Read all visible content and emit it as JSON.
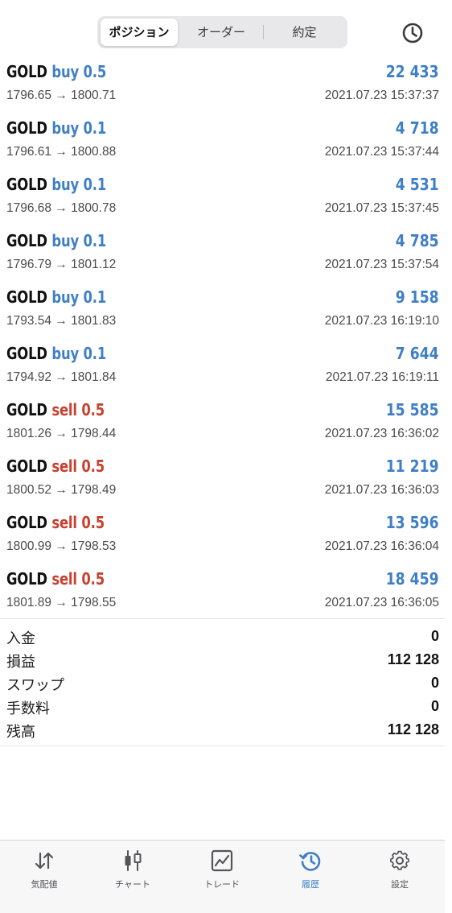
{
  "header": {
    "tabs": [
      {
        "label": "ポジション"
      },
      {
        "label": "オーダー"
      },
      {
        "label": "約定"
      }
    ],
    "active_tab": "ポジション",
    "right_icon": "clock-history-icon"
  },
  "deals": [
    {
      "symbol": "GOLD",
      "type": "buy",
      "volume": "0.5",
      "open": "1796.65",
      "close": "1800.71",
      "profit": "22 433",
      "time": "2021.07.23 15:37:37"
    },
    {
      "symbol": "GOLD",
      "type": "buy",
      "volume": "0.1",
      "open": "1796.61",
      "close": "1800.88",
      "profit": "4 718",
      "time": "2021.07.23 15:37:44"
    },
    {
      "symbol": "GOLD",
      "type": "buy",
      "volume": "0.1",
      "open": "1796.68",
      "close": "1800.78",
      "profit": "4 531",
      "time": "2021.07.23 15:37:45"
    },
    {
      "symbol": "GOLD",
      "type": "buy",
      "volume": "0.1",
      "open": "1796.79",
      "close": "1801.12",
      "profit": "4 785",
      "time": "2021.07.23 15:37:54"
    },
    {
      "symbol": "GOLD",
      "type": "buy",
      "volume": "0.1",
      "open": "1793.54",
      "close": "1801.83",
      "profit": "9 158",
      "time": "2021.07.23 16:19:10"
    },
    {
      "symbol": "GOLD",
      "type": "buy",
      "volume": "0.1",
      "open": "1794.92",
      "close": "1801.84",
      "profit": "7 644",
      "time": "2021.07.23 16:19:11"
    },
    {
      "symbol": "GOLD",
      "type": "sell",
      "volume": "0.5",
      "open": "1801.26",
      "close": "1798.44",
      "profit": "15 585",
      "time": "2021.07.23 16:36:02"
    },
    {
      "symbol": "GOLD",
      "type": "sell",
      "volume": "0.5",
      "open": "1800.52",
      "close": "1798.49",
      "profit": "11 219",
      "time": "2021.07.23 16:36:03"
    },
    {
      "symbol": "GOLD",
      "type": "sell",
      "volume": "0.5",
      "open": "1800.99",
      "close": "1798.53",
      "profit": "13 596",
      "time": "2021.07.23 16:36:04"
    },
    {
      "symbol": "GOLD",
      "type": "sell",
      "volume": "0.5",
      "open": "1801.89",
      "close": "1798.55",
      "profit": "18 459",
      "time": "2021.07.23 16:36:05"
    }
  ],
  "arrow": "→",
  "summary": [
    {
      "label": "入金",
      "value": "0"
    },
    {
      "label": "損益",
      "value": "112 128"
    },
    {
      "label": "スワップ",
      "value": "0"
    },
    {
      "label": "手数料",
      "value": "0"
    },
    {
      "label": "残高",
      "value": "112 128"
    }
  ],
  "tabbar": [
    {
      "label": "気配値",
      "icon": "quotes-arrows-icon"
    },
    {
      "label": "チャート",
      "icon": "candlestick-chart-icon"
    },
    {
      "label": "トレード",
      "icon": "trade-line-chart-icon"
    },
    {
      "label": "履歴",
      "icon": "history-clock-icon"
    },
    {
      "label": "設定",
      "icon": "gear-icon"
    }
  ],
  "active_bottom_tab": "履歴",
  "colors": {
    "buy": "#3f7fc6",
    "sell": "#c8402f",
    "profit": "#3f7fc6",
    "active_tab": "#3f7fc6"
  }
}
